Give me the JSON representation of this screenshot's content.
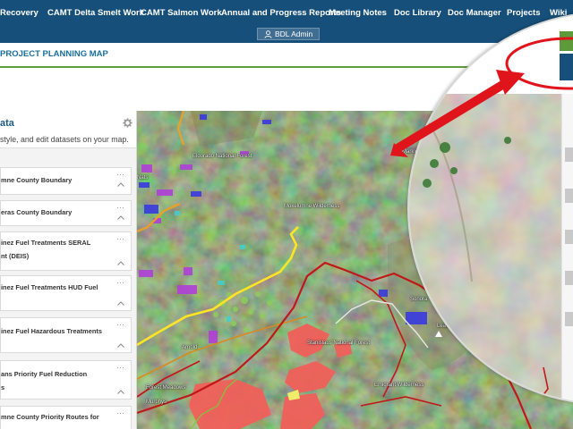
{
  "nav": {
    "items": [
      {
        "label": "Recovery"
      },
      {
        "label": "CAMT Delta Smelt Work"
      },
      {
        "label": "CAMT Salmon Work"
      },
      {
        "label": "Annual and Progress Reports"
      },
      {
        "label": "Meeting Notes"
      },
      {
        "label": "Doc Library"
      },
      {
        "label": "Doc Manager"
      },
      {
        "label": "Projects"
      },
      {
        "label": "Wiki"
      }
    ],
    "user_label": "BDL Admin"
  },
  "page": {
    "title": "PROJECT PLANNING MAP"
  },
  "panel": {
    "title": "ata",
    "subtitle": "style, and edit datasets on your map.",
    "layers": [
      {
        "lines": [
          "mne County Boundary"
        ]
      },
      {
        "lines": [
          "eras County Boundary"
        ]
      },
      {
        "lines": [
          "inez Fuel Treatments SERAL",
          "nt (DEIS)"
        ]
      },
      {
        "lines": [
          "inez Fuel Treatments HUD Fuel"
        ]
      },
      {
        "lines": [
          "inez Fuel Hazardous Treatments"
        ]
      },
      {
        "lines": [
          "ans Priority Fuel Reduction",
          "s"
        ]
      },
      {
        "lines": [
          "mne County Priority Routes for"
        ]
      }
    ]
  },
  "map": {
    "labels": [
      {
        "text": "Eldorado National Forest"
      },
      {
        "text": "Mokelumne Wilderness"
      },
      {
        "text": "Markleev"
      },
      {
        "text": "Stanislaus National Forest"
      },
      {
        "text": "Emigrant Wilderness"
      },
      {
        "text": "Arnold"
      },
      {
        "text": "Forest Meadows"
      },
      {
        "text": "Murphys"
      },
      {
        "text": "Sonora"
      },
      {
        "text": "Leavitt Pk"
      },
      {
        "text": "Nats"
      }
    ]
  },
  "colors": {
    "nav_bg": "#16507a",
    "title": "#1b6f9c",
    "title_rule": "#5f9e41",
    "annotation_red": "#e0141b",
    "fuel_treatment": "#f0605a",
    "boundary_red": "#c01818",
    "route_yellow": "#ffe426",
    "route_orange": "#f0a020"
  }
}
